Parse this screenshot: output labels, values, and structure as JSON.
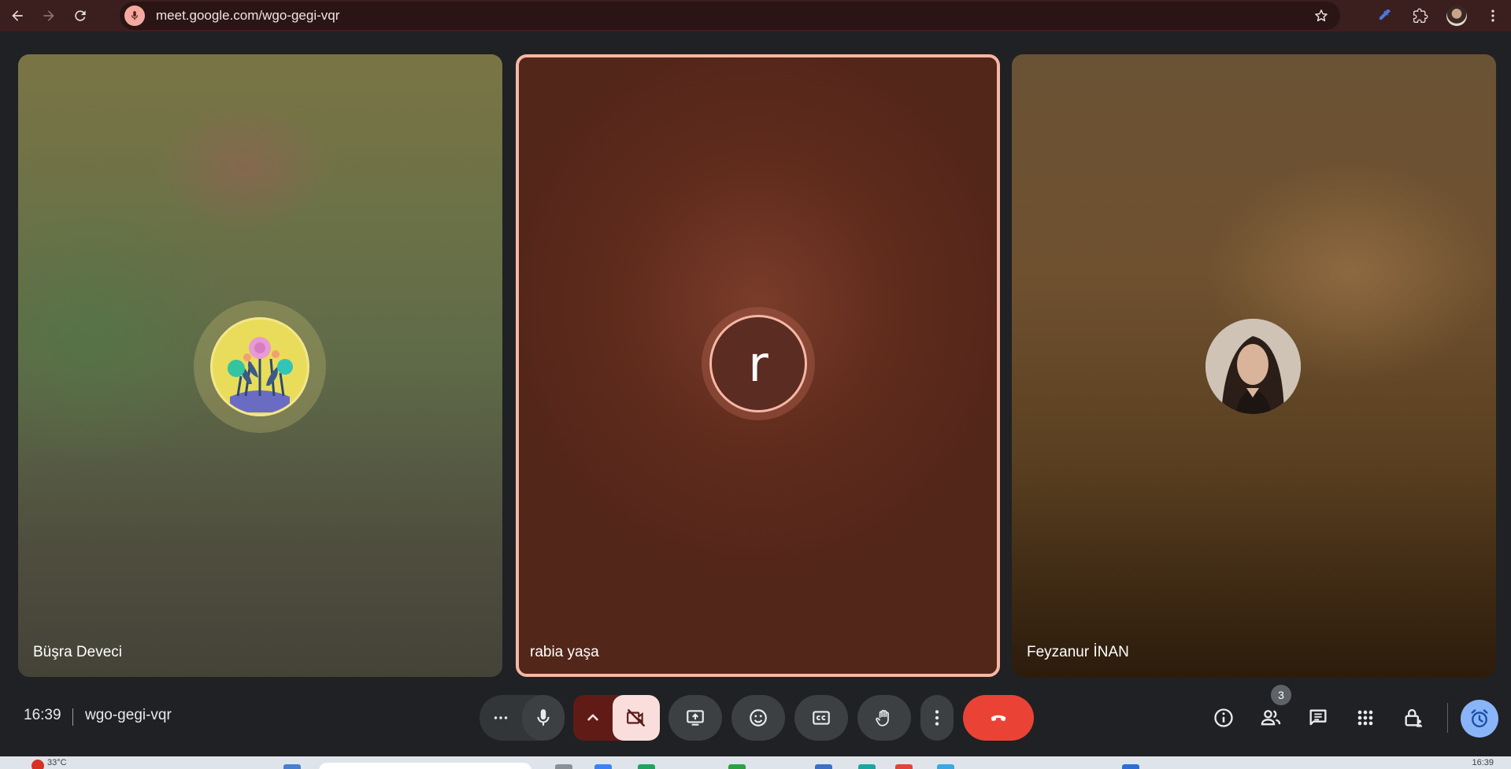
{
  "browser": {
    "url": "meet.google.com/wgo-gegi-vqr",
    "icons": [
      "back-icon",
      "forward-icon",
      "reload-icon",
      "mic-site-icon",
      "star-icon",
      "eyedropper-icon",
      "extensions-icon",
      "profile-avatar",
      "menu-icon"
    ]
  },
  "participants": [
    {
      "name": "Büşra Deveci",
      "avatar_type": "image-flowers"
    },
    {
      "name": "rabia yaşa",
      "avatar_type": "letter",
      "initial": "r",
      "active_speaker": true
    },
    {
      "name": "Feyzanur İNAN",
      "avatar_type": "photo"
    }
  ],
  "meeting": {
    "time": "16:39",
    "code": "wgo-gegi-vqr"
  },
  "controls": {
    "center": [
      "more-options",
      "microphone",
      "camera-options",
      "camera-off",
      "present-screen",
      "reactions",
      "captions",
      "raise-hand",
      "more-actions",
      "leave-call"
    ],
    "right": [
      "meeting-info",
      "people",
      "chat",
      "activities",
      "host-controls",
      "timer"
    ]
  },
  "people_count": "3",
  "colors": {
    "accent_speaker": "#f6b7a4",
    "leave": "#ea4335",
    "cam_off_bg": "#f9dedc",
    "cam_group_bg": "#611b17",
    "timer_bg": "#8ab4f8",
    "chrome_bar": "#3a1f1e"
  },
  "taskbar": {
    "weather": "33°C",
    "clock": "16:39"
  }
}
